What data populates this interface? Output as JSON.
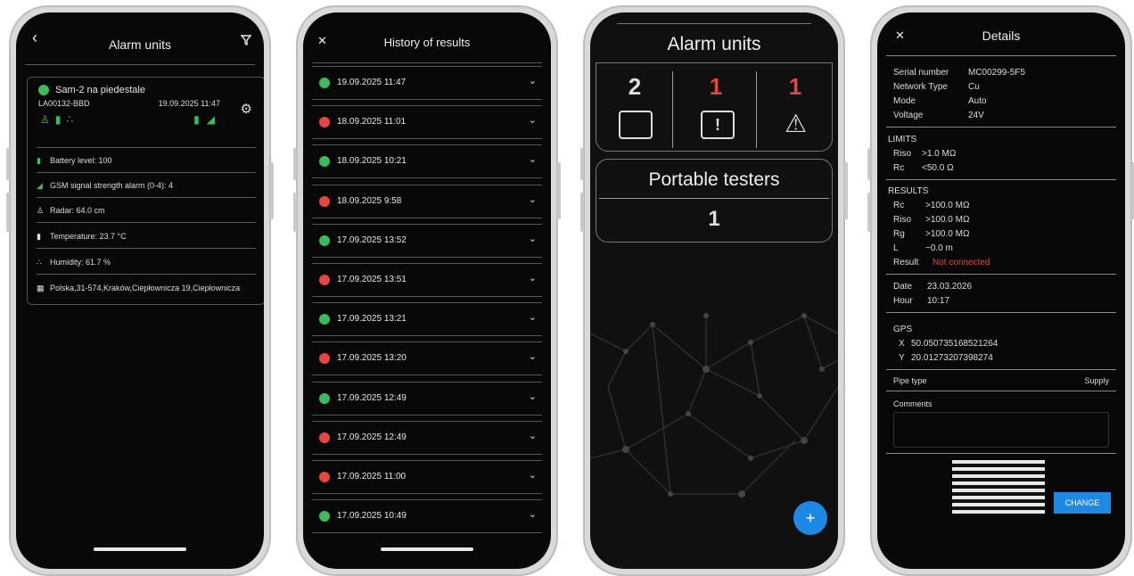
{
  "phone1": {
    "title": "Alarm units",
    "back_icon": "chevron-left-icon",
    "filter_icon": "filter-icon",
    "unit_name": "Sam-2 na piedestale",
    "unit_id": "LA00132-BBD",
    "unit_datetime": "19.09.2025 11:47",
    "rows": [
      {
        "icon": "battery-icon",
        "glyph": "▮",
        "label": "Battery level: 100"
      },
      {
        "icon": "signal-icon",
        "glyph": "◢",
        "label": "GSM signal strength alarm (0-4): 4"
      },
      {
        "icon": "radar-icon",
        "glyph": "♙",
        "label": "Radar: 64.0 cm"
      },
      {
        "icon": "thermometer-icon",
        "glyph": "🌡",
        "label": "Temperature: 23.7 °C"
      },
      {
        "icon": "humidity-icon",
        "glyph": "💧",
        "label": "Humidity: 61.7 %"
      },
      {
        "icon": "map-icon",
        "glyph": "▦",
        "label": "Polska,31-574,Kraków,Ciepłownicza 19,Ciepłownicza"
      }
    ]
  },
  "phone2": {
    "title": "History of results",
    "close_icon": "close-icon",
    "results": [
      {
        "status": "g",
        "time": "19.09.2025 11:47"
      },
      {
        "status": "r",
        "time": "18.09.2025 11:01"
      },
      {
        "status": "g",
        "time": "18.09.2025 10:21"
      },
      {
        "status": "r",
        "time": "18.09.2025 9:58"
      },
      {
        "status": "g",
        "time": "17.09.2025 13:52"
      },
      {
        "status": "r",
        "time": "17.09.2025 13:51"
      },
      {
        "status": "g",
        "time": "17.09.2025 13:21"
      },
      {
        "status": "r",
        "time": "17.09.2025 13:20"
      },
      {
        "status": "g",
        "time": "17.09.2025 12:49"
      },
      {
        "status": "r",
        "time": "17.09.2025 12:49"
      },
      {
        "status": "r",
        "time": "17.09.2025 11:00"
      },
      {
        "status": "g",
        "time": "17.09.2025 10:49"
      }
    ]
  },
  "phone3": {
    "title": "Alarm units",
    "count_all": "2",
    "count_alarm": "1",
    "count_warning": "1",
    "portable_title": "Portable testers",
    "portable_count": "1",
    "fab_label": "+"
  },
  "phone4": {
    "title": "Details",
    "serial_label": "Serial number",
    "serial_value": "MC00299-5F5",
    "network_label": "Network Type",
    "network_value": "Cu",
    "mode_label": "Mode",
    "mode_value": "Auto",
    "voltage_label": "Voltage",
    "voltage_value": "24V",
    "limits_header": "LIMITS",
    "riso_limit_label": "Riso",
    "riso_limit_value": ">1.0 MΩ",
    "rc_limit_label": "Rc",
    "rc_limit_value": "<50.0 Ω",
    "results_header": "RESULTS",
    "rc_label": "Rc",
    "rc_value": ">100.0 MΩ",
    "riso_label": "Riso",
    "riso_value": ">100.0 MΩ",
    "rg_label": "Rg",
    "rg_value": ">100.0 MΩ",
    "l_label": "L",
    "l_value": "~0.0 m",
    "result_label": "Result",
    "result_value": "Not connected",
    "date_label": "Date",
    "date_value": "23.03.2026",
    "hour_label": "Hour",
    "hour_value": "10:17",
    "gps_header": "GPS",
    "x_label": "X",
    "x_value": "50.050735168521264",
    "y_label": "Y",
    "y_value": "20.01273207398274",
    "pipe_label": "Pipe type",
    "pipe_value": "Supply",
    "comments_label": "Comments",
    "change_button": "CHANGE"
  },
  "colors": {
    "ok": "#3dbb5a",
    "alarm": "#e8463c",
    "accent": "#1e88e5"
  }
}
